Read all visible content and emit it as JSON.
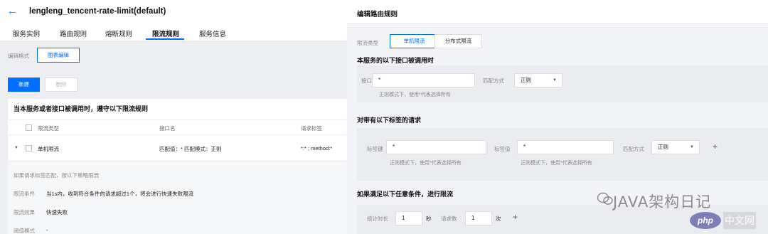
{
  "left": {
    "back_icon": "arrow-left-icon",
    "title": "lengleng_tencent-rate-limit(default)",
    "tabs": [
      {
        "label": "服务实例"
      },
      {
        "label": "路由规则"
      },
      {
        "label": "熔断规则"
      },
      {
        "label": "限流规则",
        "active": true
      },
      {
        "label": "服务信息"
      }
    ],
    "edit_format_label": "编辑格式",
    "edit_button": "图表编辑",
    "new_button": "新建",
    "delete_button": "删除",
    "card_title": "当本服务或者接口被调用时，遵守以下限流规则",
    "columns": [
      "限流类型",
      "接口名",
      "请求标签"
    ],
    "row": {
      "type": "单机限流",
      "interface": "匹配值：* 匹配模式：正则",
      "tags": "*:* ; method:*"
    },
    "detail": {
      "hint": "如果请求标签匹配，按以下策略限流",
      "condition_label": "限流条件",
      "condition_value": "当1s内，收到符合条件的请求超过1个，将会进行快速失败限流",
      "effect_label": "限流效果",
      "effect_value": "快速失败",
      "mode_label": "阈值模式",
      "mode_value": "-"
    }
  },
  "right": {
    "title": "编辑路由规则",
    "type_label": "限流类型",
    "type_options": [
      "单机限流",
      "分布式限流"
    ],
    "section1": "本服务的以下接口被调用时",
    "interface_label": "接口",
    "interface_value": "*",
    "match_label": "匹配方式",
    "match_value": "正则",
    "regex_hint": "正则模式下，使用*代表选择所有",
    "section2": "对带有以下标签的请求",
    "tag_key_label": "标签键",
    "tag_key_value": "*",
    "tag_value_label": "标签值",
    "tag_value_value": "*",
    "match2_label": "匹配方式",
    "match2_value": "正则",
    "section3": "如果满足以下任意条件，进行限流",
    "duration_label": "统计时长",
    "duration_value": "1",
    "duration_unit": "秒",
    "count_label": "请求数",
    "count_value": "1",
    "count_unit": "次"
  },
  "watermark": {
    "text": "JAVA架构日记",
    "badge1": "php",
    "badge2": "中文网"
  },
  "colors": {
    "accent": "#006eff"
  }
}
